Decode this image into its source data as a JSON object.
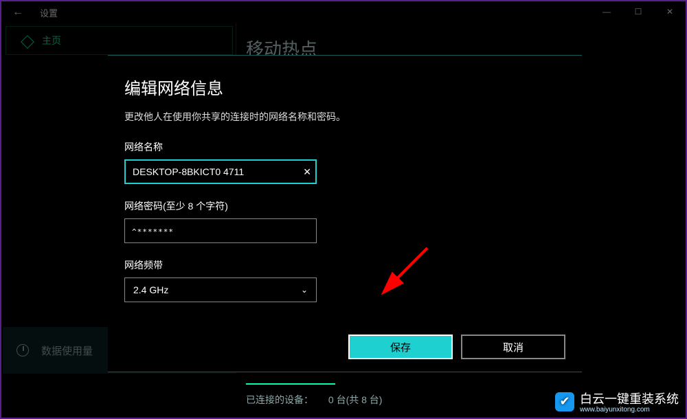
{
  "window": {
    "title": "设置",
    "minimize_tooltip": "最小化",
    "maximize_tooltip": "最大化",
    "close_tooltip": "关闭"
  },
  "sidebar": {
    "home_label": "主页",
    "data_usage_label": "数据使用量"
  },
  "main": {
    "page_title": "移动热点",
    "connected_label": "已连接的设备：",
    "connected_count": "0 台(共 8 台)"
  },
  "modal": {
    "title": "编辑网络信息",
    "subtitle": "更改他人在使用你共享的连接时的网络名称和密码。",
    "network_name_label": "网络名称",
    "network_name_value": "DESKTOP-8BKICT0 4711",
    "network_password_label": "网络密码(至少 8 个字符)",
    "network_password_value": "^*******",
    "network_band_label": "网络频带",
    "network_band_value": "2.4 GHz",
    "save_label": "保存",
    "cancel_label": "取消"
  },
  "watermark": {
    "text": "白云一键重装系统",
    "url": "www.baiyunxitong.com"
  },
  "colors": {
    "accent": "#1ed0d0",
    "highlight_green": "#00ffaa",
    "arrow": "#ff0000"
  }
}
